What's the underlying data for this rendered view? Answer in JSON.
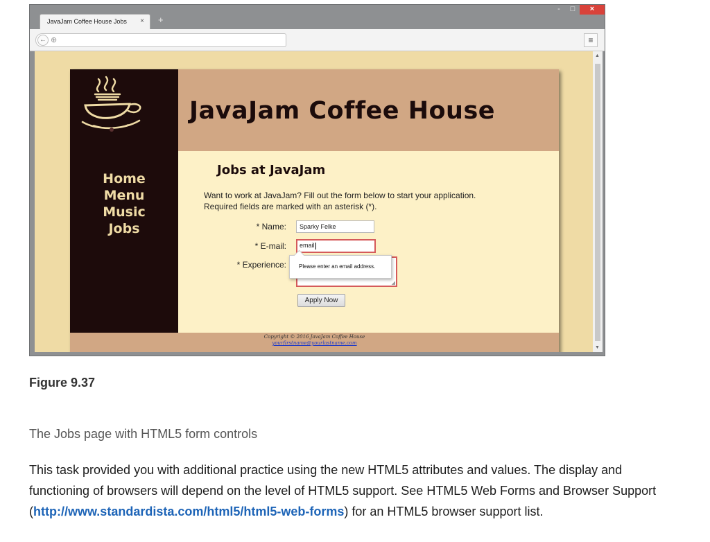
{
  "browser": {
    "tab_title": "JavaJam Coffee House Jobs",
    "tab_close": "×",
    "new_tab": "+",
    "url": "",
    "controls": {
      "minimize": "-",
      "maximize": "□",
      "close": "×"
    },
    "back": "←",
    "menu": "≡"
  },
  "site": {
    "title": "JavaJam Coffee House",
    "nav": [
      "Home",
      "Menu",
      "Music",
      "Jobs"
    ],
    "heading": "Jobs at JavaJam",
    "intro_line1": "Want to work at JavaJam? Fill out the form below to start your application.",
    "intro_line2": "Required fields are marked with an asterisk (*).",
    "form": {
      "name_label": "* Name:",
      "name_value": "Sparky Felke",
      "email_label": "* E-mail:",
      "email_value": "email",
      "experience_label": "* Experience:",
      "tooltip": "Please enter an email address.",
      "submit_label": "Apply Now"
    },
    "footer": {
      "copyright": "Copyright © 2016 JavaJam Coffee House",
      "email": "yourfirstname@yourlastname.com"
    },
    "colors": {
      "nav_bg": "#1d0b0b",
      "header_bg": "#d1a784",
      "main_bg": "#fdf1c7",
      "page_bg": "#efdba5"
    }
  },
  "figure": {
    "label": "Figure 9.37",
    "caption": "The Jobs page with HTML5 form controls"
  },
  "body": {
    "text_before": "This task provided you with additional practice using the new HTML5 attributes and values. The display and functioning of browsers will depend on the level of HTML5 support. See HTML5 Web Forms and Browser Support (",
    "link": "http://www.standardista.com/html5/html5-web-forms",
    "text_after": ") for an HTML5 browser support list."
  }
}
